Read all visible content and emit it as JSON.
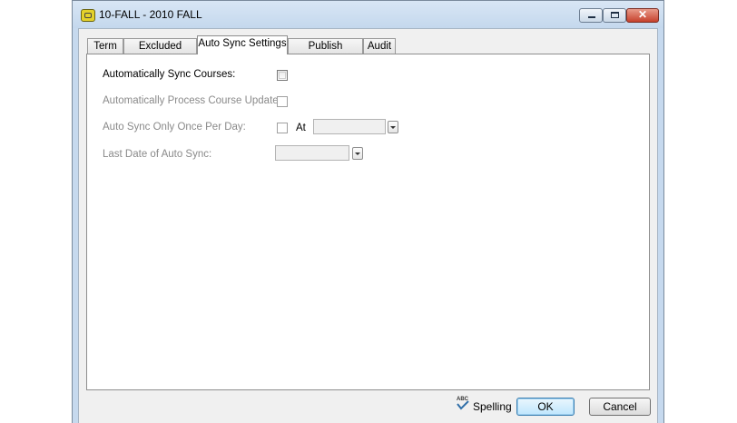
{
  "window": {
    "title": "10-FALL - 2010 FALL",
    "controls": {
      "minimize": "",
      "maximize": "",
      "close": "✕"
    }
  },
  "tabs": [
    {
      "label": "Term"
    },
    {
      "label": "Excluded Dates"
    },
    {
      "label": "Auto Sync Settings",
      "active": true
    },
    {
      "label": "Publish Settings"
    },
    {
      "label": "Audit"
    }
  ],
  "form": {
    "auto_sync_courses": {
      "label": "Automatically Sync Courses:",
      "checked": false,
      "enabled": true
    },
    "process_updates": {
      "label": "Automatically Process Course Updates:",
      "checked": false,
      "enabled": false
    },
    "once_per_day": {
      "label": "Auto Sync Only Once Per Day:",
      "checked": false,
      "at_label": "At",
      "time_value": ""
    },
    "last_date": {
      "label": "Last Date of Auto Sync:",
      "value": ""
    }
  },
  "footer": {
    "spelling": "Spelling",
    "spelling_icon": "abc-check-icon",
    "ok": "OK",
    "cancel": "Cancel"
  },
  "colors": {
    "title_bar": "#c4d8ed",
    "close_button": "#c6412c",
    "panel": "#ffffff",
    "dialog": "#f0f0f0"
  }
}
